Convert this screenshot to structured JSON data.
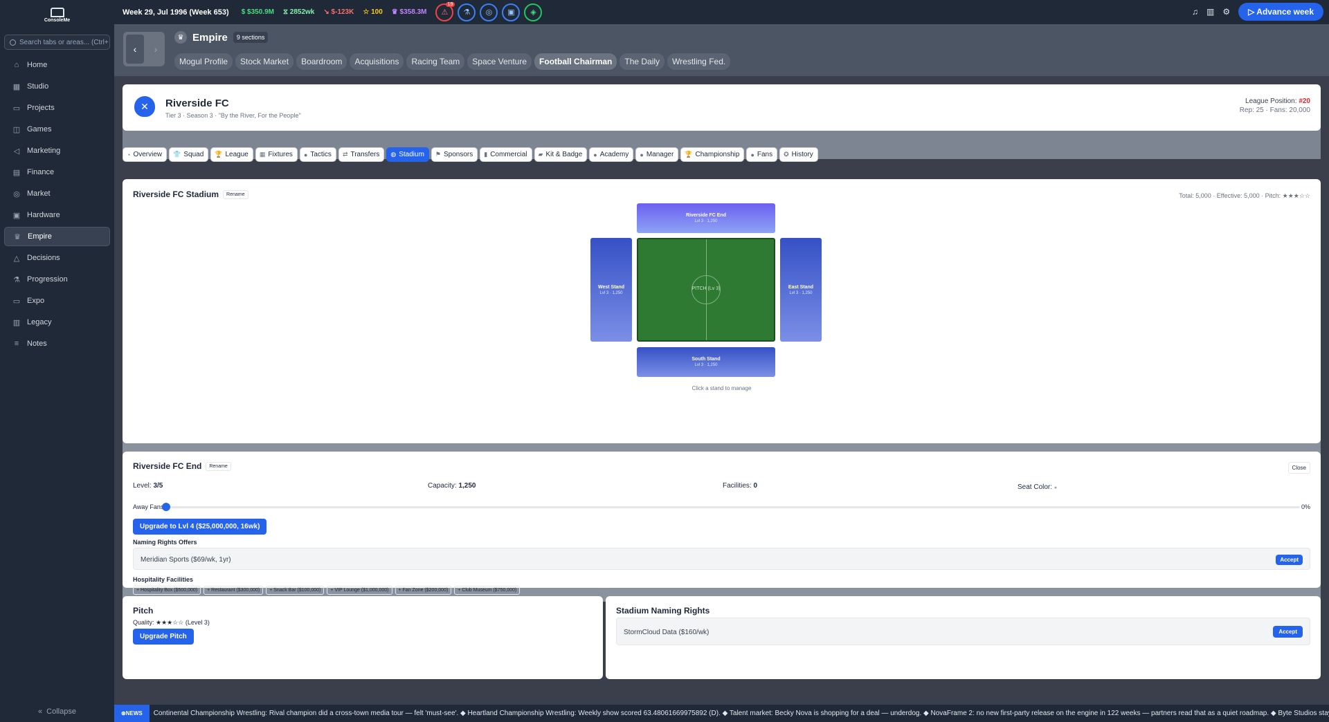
{
  "sidebar": {
    "search_placeholder": "Search tabs or areas... (Ctrl+",
    "collapse": "Collapse",
    "items": [
      {
        "label": "Home",
        "icon": "home-icon"
      },
      {
        "label": "Studio",
        "icon": "building-icon"
      },
      {
        "label": "Projects",
        "icon": "folder-icon"
      },
      {
        "label": "Games",
        "icon": "gamepad-icon"
      },
      {
        "label": "Marketing",
        "icon": "megaphone-icon"
      },
      {
        "label": "Finance",
        "icon": "bank-icon"
      },
      {
        "label": "Market",
        "icon": "globe-icon"
      },
      {
        "label": "Hardware",
        "icon": "chip-icon"
      },
      {
        "label": "Empire",
        "icon": "crown-icon",
        "active": true
      },
      {
        "label": "Decisions",
        "icon": "warning-icon"
      },
      {
        "label": "Progression",
        "icon": "flask-icon"
      },
      {
        "label": "Expo",
        "icon": "monitor-icon"
      },
      {
        "label": "Legacy",
        "icon": "book-icon"
      },
      {
        "label": "Notes",
        "icon": "notes-icon"
      }
    ]
  },
  "topbar": {
    "week": "Week 29, Jul 1996 (Week 653)",
    "cash": "$350.9M",
    "weekly": "2852wk",
    "burn": "$-123K",
    "stars": "100",
    "empire_value": "$358.3M",
    "alert_count": "19",
    "advance": "Advance week"
  },
  "empire": {
    "title": "Empire",
    "sections": "9 sections",
    "tabs": [
      "Mogul Profile",
      "Stock Market",
      "Boardroom",
      "Acquisitions",
      "Racing Team",
      "Space Venture",
      "Football Chairman",
      "The Daily",
      "Wrestling Fed."
    ],
    "active_tab": "Football Chairman"
  },
  "club": {
    "name": "Riverside FC",
    "subtitle": "Tier 3 · Season 3 · \"By the River, For the People\"",
    "league_position_label": "League Position:",
    "league_position": "#20",
    "rep_fans": "Rep: 25 · Fans: 20,000"
  },
  "subtabs": [
    {
      "label": "Overview",
      "icon": "gauge-icon"
    },
    {
      "label": "Squad",
      "icon": "shirt-icon"
    },
    {
      "label": "League",
      "icon": "trophy-icon"
    },
    {
      "label": "Fixtures",
      "icon": "calendar-icon"
    },
    {
      "label": "Tactics",
      "icon": "person-icon"
    },
    {
      "label": "Transfers",
      "icon": "transfer-icon"
    },
    {
      "label": "Stadium",
      "icon": "stadium-icon",
      "active": true
    },
    {
      "label": "Sponsors",
      "icon": "flag-icon"
    },
    {
      "label": "Commercial",
      "icon": "bottle-icon"
    },
    {
      "label": "Kit & Badge",
      "icon": "shoe-icon"
    },
    {
      "label": "Academy",
      "icon": "student-icon"
    },
    {
      "label": "Manager",
      "icon": "manager-icon"
    },
    {
      "label": "Championship",
      "icon": "trophy-icon"
    },
    {
      "label": "Fans",
      "icon": "fans-icon"
    },
    {
      "label": "History",
      "icon": "medal-icon"
    }
  ],
  "stadium": {
    "title": "Riverside FC Stadium",
    "rename": "Rename",
    "totals": "Total: 5,000 · Effective: 5,000 · Pitch: ★★★☆☆",
    "stands": {
      "north": {
        "name": "Riverside FC End",
        "level": "Lvl 3 · 1,250"
      },
      "west": {
        "name": "West Stand",
        "level": "Lvl 3 · 1,250"
      },
      "east": {
        "name": "East Stand",
        "level": "Lvl 3 · 1,250"
      },
      "south": {
        "name": "South Stand",
        "level": "Lvl 3 · 1,250"
      }
    },
    "pitch_label": "PITCH (Lv 3)",
    "hint": "Click a stand to manage"
  },
  "stand_detail": {
    "title": "Riverside FC End",
    "rename": "Rename",
    "close": "Close",
    "level_label": "Level:",
    "level": "3/5",
    "capacity_label": "Capacity:",
    "capacity": "1,250",
    "facilities_label": "Facilities:",
    "facilities": "0",
    "seat_color_label": "Seat Color:",
    "away_fans_label": "Away Fans:",
    "away_fans_pct": "0%",
    "away_fans_value": 0,
    "upgrade": "Upgrade to Lvl 4 ($25,000,000, 16wk)",
    "naming_title": "Naming Rights Offers",
    "offer": "Meridian Sports ($69/wk, 1yr)",
    "accept": "Accept",
    "hospitality_title": "Hospitality Facilities",
    "hospitality": [
      "+ Hospitality Box ($500,000)",
      "+ Restaurant ($300,000)",
      "+ Snack Bar ($100,000)",
      "+ VIP Lounge ($1,000,000)",
      "+ Fan Zone ($200,000)",
      "+ Club Museum ($750,000)"
    ]
  },
  "pitch_card": {
    "title": "Pitch",
    "quality": "Quality: ★★★☆☆ (Level 3)",
    "upgrade": "Upgrade Pitch"
  },
  "naming_card": {
    "title": "Stadium Naming Rights",
    "offer": "StormCloud Data ($160/wk)",
    "accept": "Accept"
  },
  "ticker": {
    "badge": "NEWS",
    "text": "Continental Championship Wrestling: Rival champion did a cross-town media tour — felt 'must-see'. ◆ Heartland Championship Wrestling: Weekly show scored 63.48061669975892 (D). ◆ Talent market: Becky Nova is shopping for a deal — underdog. ◆ NovaFrame 2: no new first-party release on the engine in 122 weeks — partners read that as a quiet roadmap. ◆ Byte Studios stays active"
  }
}
